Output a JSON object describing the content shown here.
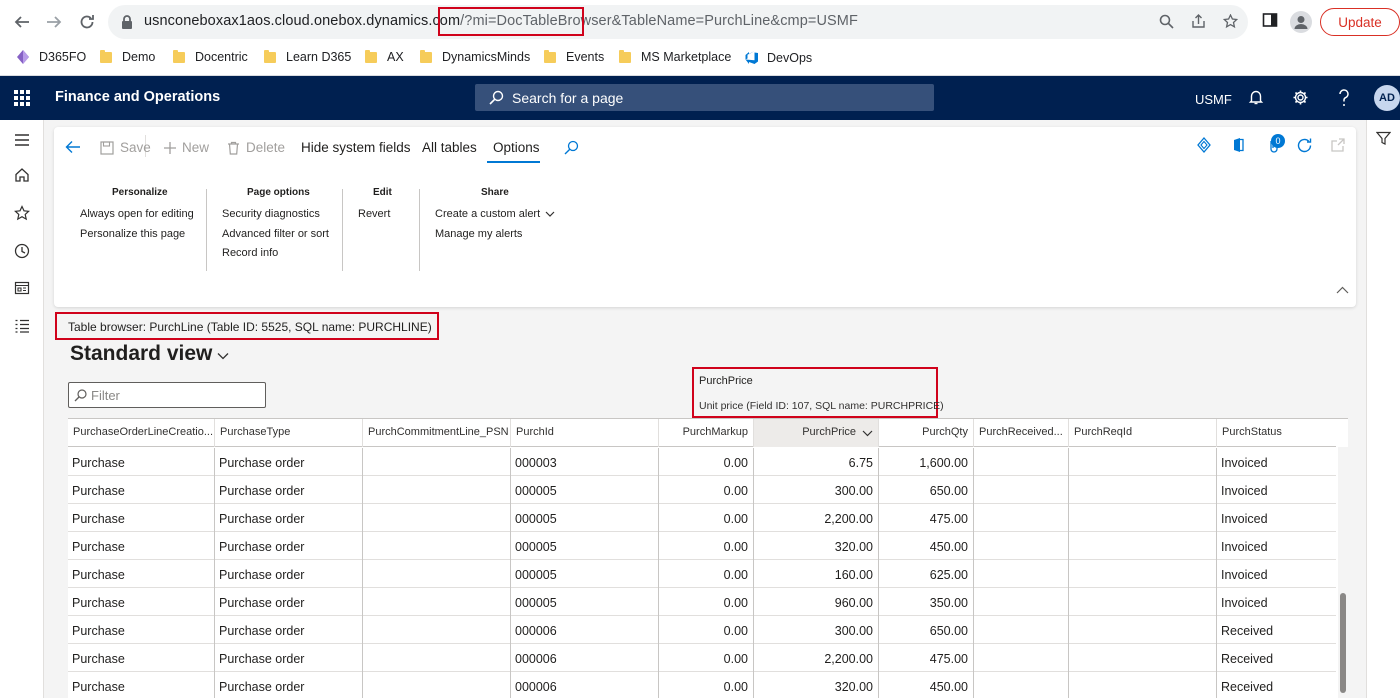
{
  "browser": {
    "url_host": "usnconeboxax1aos.cloud.onebox.dynamics.com",
    "url_path_highlight": "/?mi=DocTableBrowser",
    "url_rest": "&TableName=PurchLine&cmp=USMF",
    "update_label": "Update"
  },
  "bookmarks": [
    "D365FO",
    "Demo",
    "Docentric",
    "Learn D365",
    "AX",
    "DynamicsMinds",
    "Events",
    "MS Marketplace",
    "DevOps"
  ],
  "header": {
    "app_title": "Finance and Operations",
    "search_placeholder": "Search for a page",
    "company": "USMF",
    "user_initials": "AD"
  },
  "action_pane": {
    "save": "Save",
    "new": "New",
    "delete": "Delete",
    "hide_system_fields": "Hide system fields",
    "all_tables": "All tables",
    "options": "Options",
    "notification_count": "0"
  },
  "groups": {
    "personalize": {
      "title": "Personalize",
      "links": [
        "Always open for editing",
        "Personalize this page"
      ]
    },
    "page_options": {
      "title": "Page options",
      "links": [
        "Security diagnostics",
        "Advanced filter or sort",
        "Record info"
      ]
    },
    "edit": {
      "title": "Edit",
      "links": [
        "Revert"
      ]
    },
    "share": {
      "title": "Share",
      "links": [
        "Create a custom alert",
        "Manage my alerts"
      ]
    }
  },
  "caption": "Table browser: PurchLine (Table ID: 5525, SQL name: PURCHLINE)",
  "view_title": "Standard view",
  "filter_placeholder": "Filter",
  "tooltip": {
    "title": "PurchPrice",
    "description": "Unit price (Field ID: 107, SQL name: PURCHPRICE)"
  },
  "grid": {
    "columns": [
      "PurchaseOrderLineCreatio...",
      "PurchaseType",
      "PurchCommitmentLine_PSN",
      "PurchId",
      "PurchMarkup",
      "PurchPrice",
      "PurchQty",
      "PurchReceived...",
      "PurchReqId",
      "PurchStatus"
    ],
    "rows": [
      [
        "Purchase",
        "Purchase order",
        "",
        "000003",
        "0.00",
        "6.75",
        "1,600.00",
        "",
        "",
        "Invoiced"
      ],
      [
        "Purchase",
        "Purchase order",
        "",
        "000005",
        "0.00",
        "300.00",
        "650.00",
        "",
        "",
        "Invoiced"
      ],
      [
        "Purchase",
        "Purchase order",
        "",
        "000005",
        "0.00",
        "2,200.00",
        "475.00",
        "",
        "",
        "Invoiced"
      ],
      [
        "Purchase",
        "Purchase order",
        "",
        "000005",
        "0.00",
        "320.00",
        "450.00",
        "",
        "",
        "Invoiced"
      ],
      [
        "Purchase",
        "Purchase order",
        "",
        "000005",
        "0.00",
        "160.00",
        "625.00",
        "",
        "",
        "Invoiced"
      ],
      [
        "Purchase",
        "Purchase order",
        "",
        "000005",
        "0.00",
        "960.00",
        "350.00",
        "",
        "",
        "Invoiced"
      ],
      [
        "Purchase",
        "Purchase order",
        "",
        "000006",
        "0.00",
        "300.00",
        "650.00",
        "",
        "",
        "Received"
      ],
      [
        "Purchase",
        "Purchase order",
        "",
        "000006",
        "0.00",
        "2,200.00",
        "475.00",
        "",
        "",
        "Received"
      ],
      [
        "Purchase",
        "Purchase order",
        "",
        "000006",
        "0.00",
        "320.00",
        "450.00",
        "",
        "",
        "Received"
      ]
    ]
  }
}
